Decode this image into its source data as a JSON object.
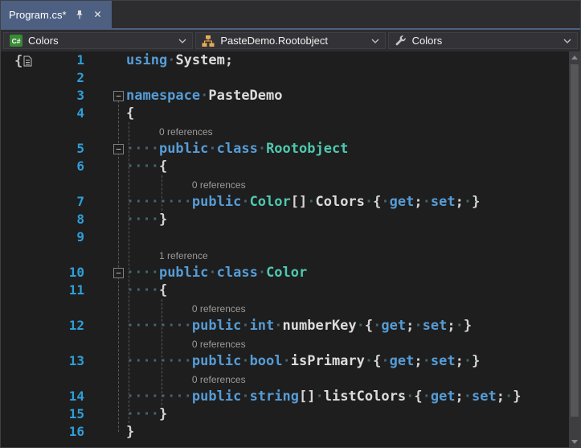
{
  "window": {
    "tab": {
      "title": "Program.cs*"
    }
  },
  "navbar": {
    "project": {
      "label": "Colors",
      "icon": "csharp-project-icon"
    },
    "type": {
      "label": "PasteDemo.Rootobject",
      "icon": "class-icon"
    },
    "member": {
      "label": "Colors",
      "icon": "wrench-icon"
    }
  },
  "colors": {
    "editor_background": "#1E1E1E",
    "keyword": "#569CD6",
    "type_name": "#4EC9B0",
    "identifier": "#DCDCDC",
    "line_number": "#2E9FD8",
    "codelens_text": "#9B9B9B",
    "whitespace_dot": "#456570",
    "active_tab": "#4D6082",
    "class_icon": "#E8AB53",
    "csharp_icon": "#388A34"
  },
  "editor": {
    "rows": [
      {
        "kind": "code",
        "num": "1",
        "tokens": [
          [
            "kw",
            "using"
          ],
          [
            "ws",
            " "
          ],
          [
            "id",
            "System"
          ],
          [
            "pu",
            ";"
          ]
        ]
      },
      {
        "kind": "code",
        "num": "2",
        "tokens": []
      },
      {
        "kind": "code",
        "num": "3",
        "fold": true,
        "tokens": [
          [
            "kw",
            "namespace"
          ],
          [
            "ws",
            " "
          ],
          [
            "id",
            "PasteDemo"
          ]
        ]
      },
      {
        "kind": "code",
        "num": "4",
        "tokens": [
          [
            "pu",
            "{"
          ]
        ]
      },
      {
        "kind": "lens",
        "indent": 4,
        "text": "0 references"
      },
      {
        "kind": "code",
        "num": "5",
        "fold": true,
        "tokens": [
          [
            "ws",
            "    "
          ],
          [
            "kw",
            "public"
          ],
          [
            "ws",
            " "
          ],
          [
            "kw",
            "class"
          ],
          [
            "ws",
            " "
          ],
          [
            "ty",
            "Rootobject"
          ]
        ]
      },
      {
        "kind": "code",
        "num": "6",
        "tokens": [
          [
            "ws",
            "    "
          ],
          [
            "pu",
            "{"
          ]
        ]
      },
      {
        "kind": "lens",
        "indent": 8,
        "text": "0 references"
      },
      {
        "kind": "code",
        "num": "7",
        "tokens": [
          [
            "ws",
            "        "
          ],
          [
            "kw",
            "public"
          ],
          [
            "ws",
            " "
          ],
          [
            "ty",
            "Color"
          ],
          [
            "pu",
            "[]"
          ],
          [
            "ws",
            " "
          ],
          [
            "id",
            "Colors"
          ],
          [
            "ws",
            " "
          ],
          [
            "pu",
            "{"
          ],
          [
            "ws",
            " "
          ],
          [
            "kw",
            "get"
          ],
          [
            "pu",
            ";"
          ],
          [
            "ws",
            " "
          ],
          [
            "kw",
            "set"
          ],
          [
            "pu",
            ";"
          ],
          [
            "ws",
            " "
          ],
          [
            "pu",
            "}"
          ]
        ]
      },
      {
        "kind": "code",
        "num": "8",
        "tokens": [
          [
            "ws",
            "    "
          ],
          [
            "pu",
            "}"
          ]
        ]
      },
      {
        "kind": "code",
        "num": "9",
        "tokens": []
      },
      {
        "kind": "lens",
        "indent": 4,
        "text": "1 reference"
      },
      {
        "kind": "code",
        "num": "10",
        "fold": true,
        "tokens": [
          [
            "ws",
            "    "
          ],
          [
            "kw",
            "public"
          ],
          [
            "ws",
            " "
          ],
          [
            "kw",
            "class"
          ],
          [
            "ws",
            " "
          ],
          [
            "ty",
            "Color"
          ]
        ]
      },
      {
        "kind": "code",
        "num": "11",
        "tokens": [
          [
            "ws",
            "    "
          ],
          [
            "pu",
            "{"
          ]
        ]
      },
      {
        "kind": "lens",
        "indent": 8,
        "text": "0 references"
      },
      {
        "kind": "code",
        "num": "12",
        "tokens": [
          [
            "ws",
            "        "
          ],
          [
            "kw",
            "public"
          ],
          [
            "ws",
            " "
          ],
          [
            "kw",
            "int"
          ],
          [
            "ws",
            " "
          ],
          [
            "id",
            "numberKey"
          ],
          [
            "ws",
            " "
          ],
          [
            "pu",
            "{"
          ],
          [
            "ws",
            " "
          ],
          [
            "kw",
            "get"
          ],
          [
            "pu",
            ";"
          ],
          [
            "ws",
            " "
          ],
          [
            "kw",
            "set"
          ],
          [
            "pu",
            ";"
          ],
          [
            "ws",
            " "
          ],
          [
            "pu",
            "}"
          ]
        ]
      },
      {
        "kind": "lens",
        "indent": 8,
        "text": "0 references"
      },
      {
        "kind": "code",
        "num": "13",
        "tokens": [
          [
            "ws",
            "        "
          ],
          [
            "kw",
            "public"
          ],
          [
            "ws",
            " "
          ],
          [
            "kw",
            "bool"
          ],
          [
            "ws",
            " "
          ],
          [
            "id",
            "isPrimary"
          ],
          [
            "ws",
            " "
          ],
          [
            "pu",
            "{"
          ],
          [
            "ws",
            " "
          ],
          [
            "kw",
            "get"
          ],
          [
            "pu",
            ";"
          ],
          [
            "ws",
            " "
          ],
          [
            "kw",
            "set"
          ],
          [
            "pu",
            ";"
          ],
          [
            "ws",
            " "
          ],
          [
            "pu",
            "}"
          ]
        ]
      },
      {
        "kind": "lens",
        "indent": 8,
        "text": "0 references"
      },
      {
        "kind": "code",
        "num": "14",
        "tokens": [
          [
            "ws",
            "        "
          ],
          [
            "kw",
            "public"
          ],
          [
            "ws",
            " "
          ],
          [
            "kw",
            "string"
          ],
          [
            "pu",
            "[]"
          ],
          [
            "ws",
            " "
          ],
          [
            "id",
            "listColors"
          ],
          [
            "ws",
            " "
          ],
          [
            "pu",
            "{"
          ],
          [
            "ws",
            " "
          ],
          [
            "kw",
            "get"
          ],
          [
            "pu",
            ";"
          ],
          [
            "ws",
            " "
          ],
          [
            "kw",
            "set"
          ],
          [
            "pu",
            ";"
          ],
          [
            "ws",
            " "
          ],
          [
            "pu",
            "}"
          ]
        ]
      },
      {
        "kind": "code",
        "num": "15",
        "tokens": [
          [
            "ws",
            "    "
          ],
          [
            "pu",
            "}"
          ]
        ]
      },
      {
        "kind": "code",
        "num": "16",
        "tokens": [
          [
            "pu",
            "}"
          ]
        ]
      }
    ]
  }
}
